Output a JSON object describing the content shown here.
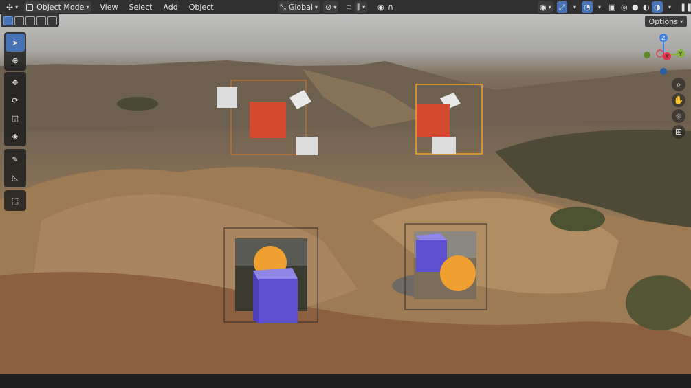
{
  "header": {
    "mode_label": "Object Mode",
    "menus": [
      "View",
      "Select",
      "Add",
      "Object"
    ],
    "transform_orientation": "Global"
  },
  "viewport": {
    "options_label": "Options",
    "gizmo": {
      "z": "Z",
      "x": "X",
      "y": "Y"
    }
  },
  "colors": {
    "header_bg": "#303030",
    "active_tool": "#4772b3",
    "red_cube": "#d44a30",
    "purple_cube": "#5d4fd0",
    "orange_sphere": "#f0a030",
    "gizmo_x": "#e0364d",
    "gizmo_y": "#85b33a",
    "gizmo_z": "#3e82e6"
  },
  "icons": {
    "toolbar": [
      "select-box-icon",
      "cursor-icon",
      "move-icon",
      "rotate-icon",
      "scale-icon",
      "transform-icon",
      "annotate-icon",
      "measure-icon",
      "add-cube-icon"
    ],
    "nav": [
      "zoom-icon",
      "pan-hand-icon",
      "camera-icon",
      "grid-perspective-icon"
    ]
  }
}
